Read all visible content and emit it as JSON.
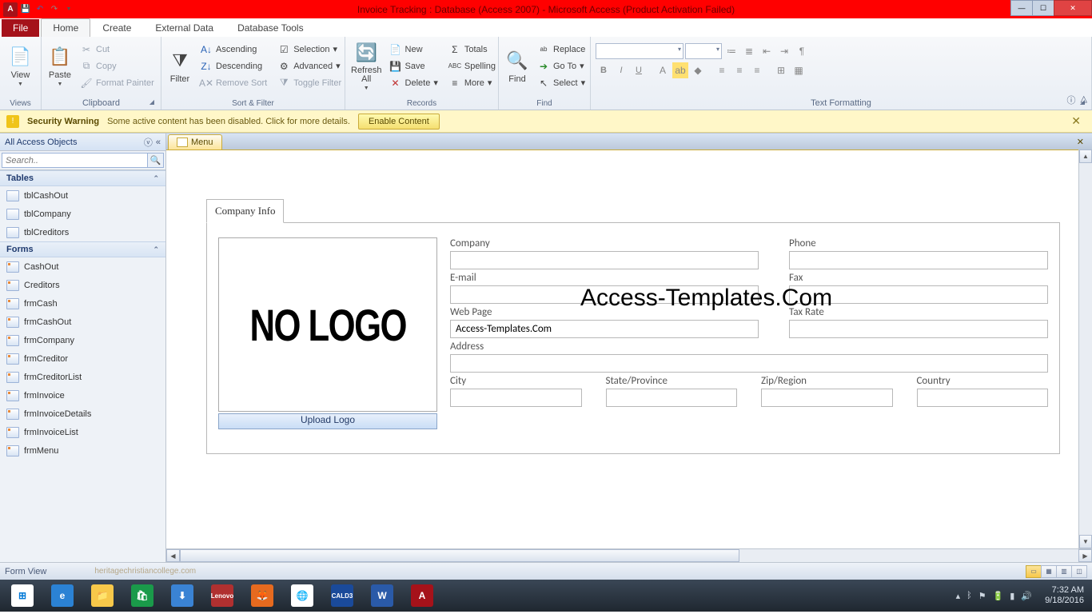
{
  "title": "Invoice Tracking : Database (Access 2007) - Microsoft Access (Product Activation Failed)",
  "ribbon": {
    "file": "File",
    "tabs": [
      "Home",
      "Create",
      "External Data",
      "Database Tools"
    ],
    "activeTab": 0,
    "groups": {
      "views": {
        "label": "Views",
        "view": "View"
      },
      "clipboard": {
        "label": "Clipboard",
        "paste": "Paste",
        "cut": "Cut",
        "copy": "Copy",
        "fmtpainter": "Format Painter"
      },
      "sortfilter": {
        "label": "Sort & Filter",
        "filter": "Filter",
        "asc": "Ascending",
        "desc": "Descending",
        "remove": "Remove Sort",
        "selection": "Selection",
        "advanced": "Advanced",
        "toggle": "Toggle Filter"
      },
      "records": {
        "label": "Records",
        "refresh": "Refresh\nAll",
        "new": "New",
        "save": "Save",
        "delete": "Delete",
        "totals": "Totals",
        "spelling": "Spelling",
        "more": "More"
      },
      "find": {
        "label": "Find",
        "find": "Find",
        "replace": "Replace",
        "goto": "Go To",
        "select": "Select"
      },
      "textfmt": {
        "label": "Text Formatting"
      }
    }
  },
  "security": {
    "title": "Security Warning",
    "msg": "Some active content has been disabled. Click for more details.",
    "enable": "Enable Content"
  },
  "nav": {
    "header": "All Access Objects",
    "searchPlaceholder": "Search..",
    "groups": [
      {
        "name": "Tables",
        "items": [
          "tblCashOut",
          "tblCompany",
          "tblCreditors"
        ]
      },
      {
        "name": "Forms",
        "items": [
          "CashOut",
          "Creditors",
          "frmCash",
          "frmCashOut",
          "frmCompany",
          "frmCreditor",
          "frmCreditorList",
          "frmInvoice",
          "frmInvoiceDetails",
          "frmInvoiceList",
          "frmMenu"
        ]
      }
    ]
  },
  "docTab": "Menu",
  "form": {
    "tab": "Company Info",
    "nologo": "NO LOGO",
    "upload": "Upload Logo",
    "labels": {
      "company": "Company",
      "phone": "Phone",
      "email": "E-mail",
      "fax": "Fax",
      "webpage": "Web Page",
      "taxrate": "Tax Rate",
      "address": "Address",
      "city": "City",
      "state": "State/Province",
      "zip": "Zip/Region",
      "country": "Country"
    },
    "values": {
      "webpage": "Access-Templates.Com"
    }
  },
  "watermark": "Access-Templates.Com",
  "status": {
    "label": "Form View",
    "wm": "heritagechristiancollege.com"
  },
  "clock": {
    "time": "7:32 AM",
    "date": "9/18/2016"
  }
}
